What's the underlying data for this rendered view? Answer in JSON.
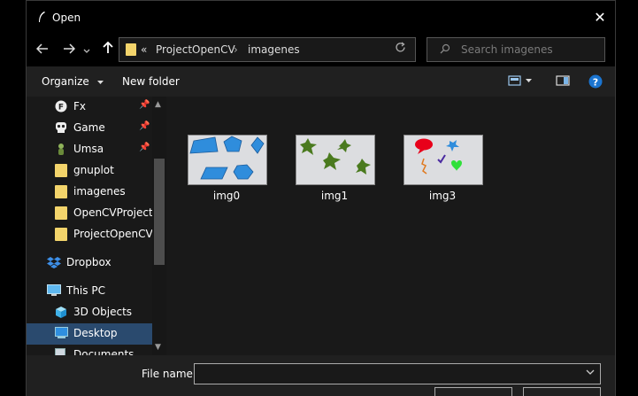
{
  "window": {
    "title": "Open",
    "close_glyph": "✕"
  },
  "nav": {
    "back_icon": "arrow-left-icon",
    "forward_icon": "arrow-right-icon",
    "recent_icon": "chevron-down-icon",
    "up_icon": "arrow-up-icon"
  },
  "address": {
    "overflow": "«",
    "path": [
      "ProjectOpenCV",
      "imagenes"
    ],
    "separator": "›"
  },
  "search": {
    "placeholder": "Search imagenes"
  },
  "commands": {
    "organize": "Organize",
    "new_folder": "New folder"
  },
  "sidebar": {
    "items": [
      {
        "label": "Fx",
        "icon": "app-fx-icon",
        "pinned": true
      },
      {
        "label": "Game",
        "icon": "skull-icon",
        "pinned": true
      },
      {
        "label": "Umsa",
        "icon": "person-icon",
        "pinned": true
      },
      {
        "label": "gnuplot",
        "icon": "folder-icon",
        "pinned": false
      },
      {
        "label": "imagenes",
        "icon": "folder-icon",
        "pinned": false
      },
      {
        "label": "OpenCVProject",
        "icon": "folder-icon",
        "pinned": false
      },
      {
        "label": "ProjectOpenCV",
        "icon": "folder-icon",
        "pinned": false
      },
      {
        "label": "Dropbox",
        "icon": "dropbox-icon",
        "pinned": false
      },
      {
        "label": "This PC",
        "icon": "computer-icon",
        "pinned": false
      },
      {
        "label": "3D Objects",
        "icon": "cube-icon",
        "pinned": false
      },
      {
        "label": "Desktop",
        "icon": "desktop-icon",
        "pinned": false,
        "selected": true
      },
      {
        "label": "Documents",
        "icon": "document-icon",
        "pinned": false
      }
    ]
  },
  "files": [
    {
      "name": "img0"
    },
    {
      "name": "img1"
    },
    {
      "name": "img3"
    }
  ],
  "footer": {
    "file_name_label": "File name:",
    "file_name_value": ""
  },
  "colors": {
    "folder": "#f3d46b",
    "accent": "#2a4a6e",
    "shape_blue": "#2f8ddc",
    "shape_green": "#4a7a1e"
  }
}
